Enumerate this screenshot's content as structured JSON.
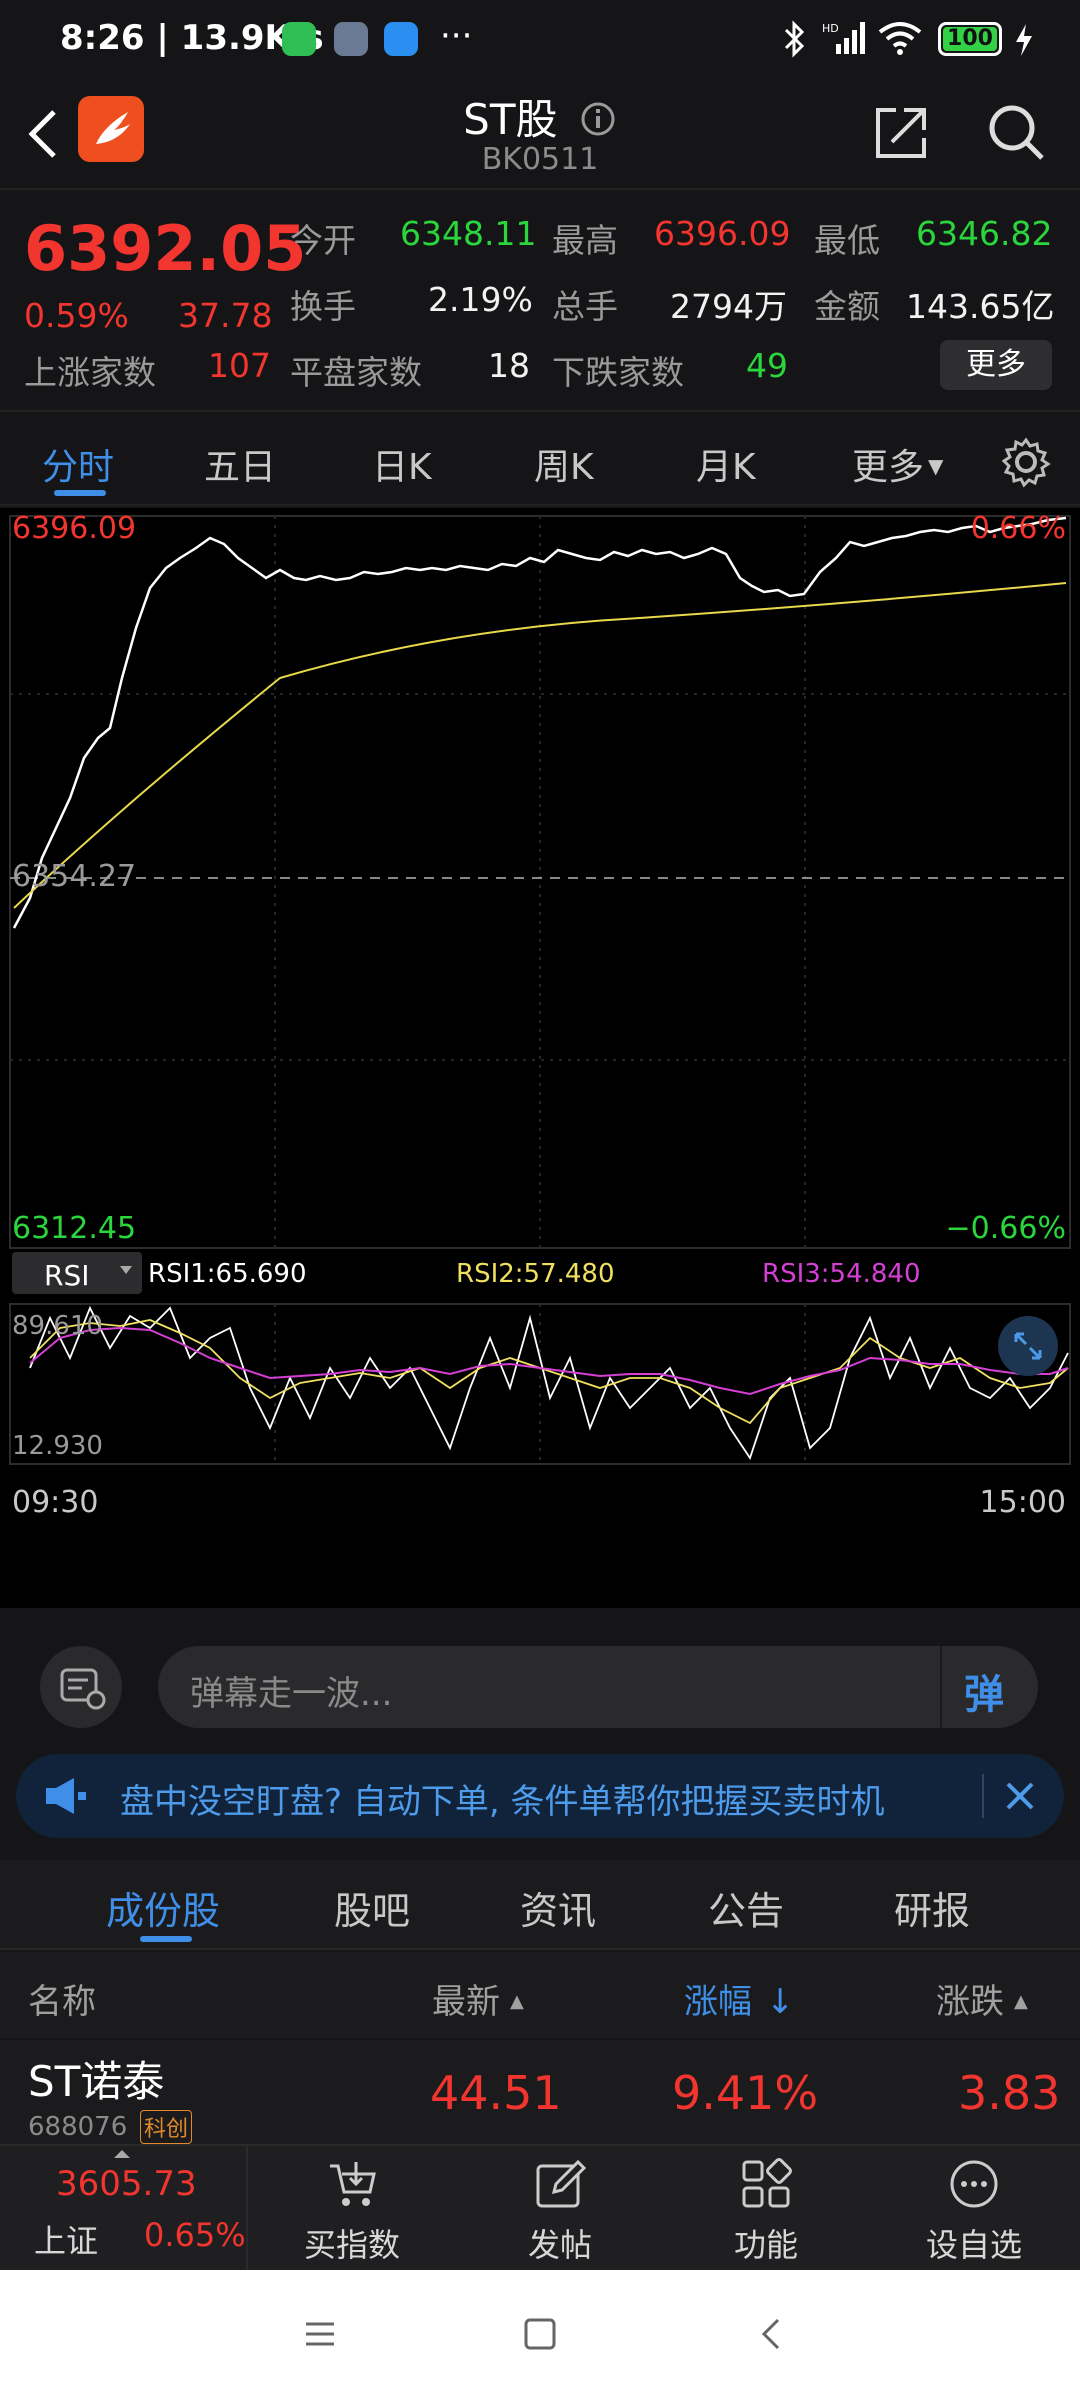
{
  "status_bar": {
    "time": "8:26 | 13.9K/s",
    "more": "···",
    "battery": "100"
  },
  "header": {
    "title": "ST股",
    "code": "BK0511"
  },
  "quote": {
    "price": "6392.05",
    "change_pct": "0.59%",
    "change": "37.78",
    "open_label": "今开",
    "open_value": "6348.11",
    "high_label": "最高",
    "high_value": "6396.09",
    "low_label": "最低",
    "low_value": "6346.82",
    "turnover_label": "换手",
    "turnover_value": "2.19%",
    "volume_label": "总手",
    "volume_value": "2794万",
    "amount_label": "金额",
    "amount_value": "143.65亿",
    "up_label": "上涨家数",
    "up_value": "107",
    "flat_label": "平盘家数",
    "flat_value": "18",
    "down_label": "下跌家数",
    "down_value": "49",
    "more_button": "更多"
  },
  "period_tabs": [
    {
      "label": "分时"
    },
    {
      "label": "五日"
    },
    {
      "label": "日K"
    },
    {
      "label": "周K"
    },
    {
      "label": "月K"
    },
    {
      "label": "更多"
    }
  ],
  "chart": {
    "price_high": "6396.09",
    "price_low": "6312.45",
    "pct_high": "0.66%",
    "pct_low": "−0.66%",
    "prev_close": "6354.27",
    "indicator": "RSI",
    "rsi1": "RSI1:65.690",
    "rsi2": "RSI2:57.480",
    "rsi3": "RSI3:54.840",
    "rsi_max": "89.610",
    "rsi_min": "12.930",
    "time_start": "09:30",
    "time_end": "15:00",
    "colors": {
      "price_line": "#ffffff",
      "avg_line": "#e8d84a",
      "rsi1": "#ffffff",
      "rsi2": "#f0e060",
      "rsi3": "#d43fd4"
    }
  },
  "barrage": {
    "placeholder": "弹幕走一波...",
    "button": "弹"
  },
  "ad": {
    "text": "盘中没空盯盘? 自动下单, 条件单帮你把握买卖时机"
  },
  "content_tabs": [
    {
      "label": "成份股"
    },
    {
      "label": "股吧"
    },
    {
      "label": "资讯"
    },
    {
      "label": "公告"
    },
    {
      "label": "研报"
    }
  ],
  "list_header": {
    "name": "名称",
    "latest": "最新",
    "change_pct": "涨幅",
    "change": "涨跌"
  },
  "rows": [
    {
      "name": "ST诺泰",
      "code": "688076",
      "tag": "科创",
      "latest": "44.51",
      "change_pct": "9.41%",
      "change": "3.83"
    }
  ],
  "bottom_nav": {
    "index_value": "3605.73",
    "index_name": "上证",
    "index_pct": "0.65%",
    "items": [
      {
        "label": "买指数"
      },
      {
        "label": "发帖"
      },
      {
        "label": "功能"
      },
      {
        "label": "设自选"
      }
    ]
  }
}
